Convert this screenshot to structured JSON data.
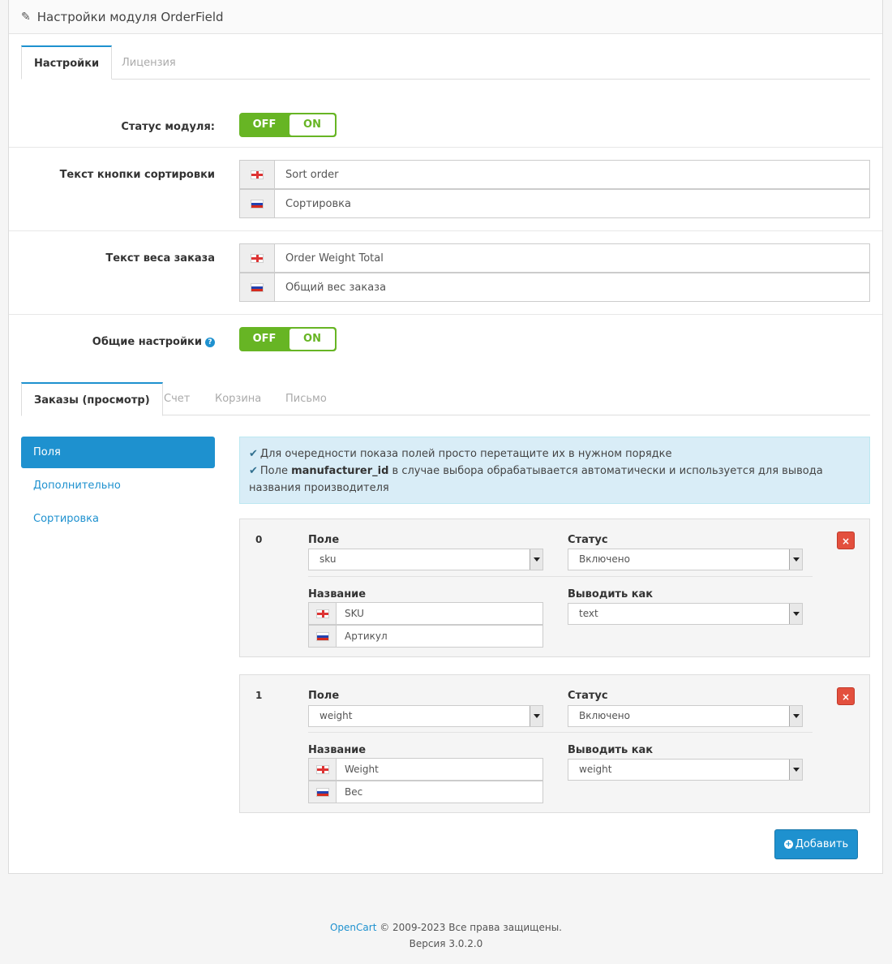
{
  "header": {
    "title": "Настройки модуля OrderField",
    "icon": "pencil-icon"
  },
  "top_tabs": [
    {
      "label": "Настройки",
      "active": true
    },
    {
      "label": "Лицензия",
      "active": false
    }
  ],
  "settings": {
    "module_status": {
      "label": "Статус модуля:",
      "off": "OFF",
      "on": "ON"
    },
    "sort_button_text": {
      "label": "Текст кнопки сортировки",
      "values": [
        {
          "lang": "en-flag-icon",
          "value": "Sort order"
        },
        {
          "lang": "ru-flag-icon",
          "value": "Сортировка"
        }
      ]
    },
    "order_weight_text": {
      "label": "Текст веса заказа",
      "values": [
        {
          "lang": "en-flag-icon",
          "value": "Order Weight Total"
        },
        {
          "lang": "ru-flag-icon",
          "value": "Общий вес заказа"
        }
      ]
    },
    "general": {
      "label": "Общие настройки",
      "help": "?",
      "off": "OFF",
      "on": "ON"
    }
  },
  "sub_tabs": [
    {
      "label": "Заказы (просмотр)",
      "active": true
    },
    {
      "label": "Счет",
      "active": false
    },
    {
      "label": "Корзина",
      "active": false
    },
    {
      "label": "Письмо",
      "active": false
    }
  ],
  "sidebar": {
    "items": [
      {
        "label": "Поля",
        "active": true
      },
      {
        "label": "Дополнительно",
        "active": false
      },
      {
        "label": "Сортировка",
        "active": false
      }
    ]
  },
  "info": {
    "line1": "Для очередности показа полей просто перетащите их в нужном порядке",
    "line2_prefix": "Поле ",
    "line2_bold": "manufacturer_id",
    "line2_suffix": " в случае выбора обрабатывается автоматически и используется для вывода названия производителя"
  },
  "field_labels": {
    "field": "Поле",
    "status": "Статус",
    "name": "Название",
    "output_as": "Выводить как"
  },
  "fields": [
    {
      "index": "0",
      "field": "sku",
      "status": "Включено",
      "name_en": "SKU",
      "name_ru": "Артикул",
      "output_as": "text"
    },
    {
      "index": "1",
      "field": "weight",
      "status": "Включено",
      "name_en": "Weight",
      "name_ru": "Вес",
      "output_as": "weight"
    }
  ],
  "delete_label": "×",
  "add_button": {
    "label": "Добавить"
  },
  "footer": {
    "brand": "OpenCart",
    "copyright": " © 2009-2023 Все права защищены.",
    "version": "Версия 3.0.2.0"
  },
  "colors": {
    "accent": "#1e91cf",
    "toggle": "#67b524",
    "danger": "#e3503e",
    "info_bg": "#d9edf7"
  }
}
